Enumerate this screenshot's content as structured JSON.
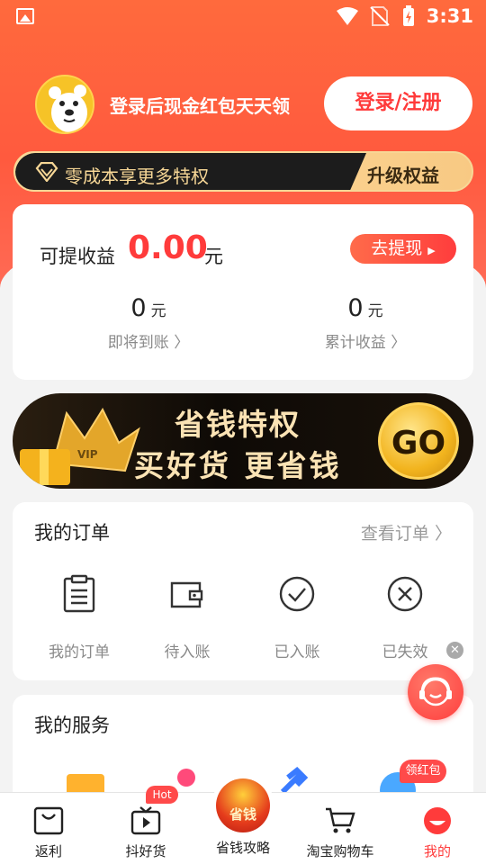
{
  "status_bar": {
    "time": "3:31"
  },
  "header": {
    "login_tip": "登录后现金红包天天领",
    "login_button": "登录/注册"
  },
  "vip": {
    "text": "零成本享更多特权",
    "upgrade": "升级权益"
  },
  "earnings": {
    "label": "可提收益",
    "amount": "0.00",
    "unit": "元",
    "withdraw": "去提现",
    "stats": [
      {
        "value": "0",
        "unit": "元",
        "label": "即将到账"
      },
      {
        "value": "0",
        "unit": "元",
        "label": "累计收益"
      }
    ]
  },
  "banner": {
    "line1": "省钱特权",
    "line2": "买好货 更省钱",
    "go": "GO"
  },
  "orders": {
    "title": "我的订单",
    "view_all": "查看订单",
    "items": [
      {
        "label": "我的订单",
        "icon": "clipboard-icon"
      },
      {
        "label": "待入账",
        "icon": "wallet-icon"
      },
      {
        "label": "已入账",
        "icon": "check-circle-icon"
      },
      {
        "label": "已失效",
        "icon": "x-circle-icon"
      }
    ]
  },
  "services": {
    "title": "我的服务",
    "badge": "领红包"
  },
  "tabbar": {
    "hot_badge": "Hot",
    "center_label": "省钱",
    "items": [
      {
        "label": "返利",
        "icon": "bag-icon"
      },
      {
        "label": "抖好货",
        "icon": "tv-icon"
      },
      {
        "label": "省钱攻略",
        "icon": "money-bag-icon"
      },
      {
        "label": "淘宝购物车",
        "icon": "cart-icon"
      },
      {
        "label": "我的",
        "icon": "profile-icon"
      }
    ],
    "active_index": 4
  },
  "colors": {
    "accent": "#ff3b3b",
    "hero": "#ff6a3d",
    "gold": "#f7d796"
  }
}
